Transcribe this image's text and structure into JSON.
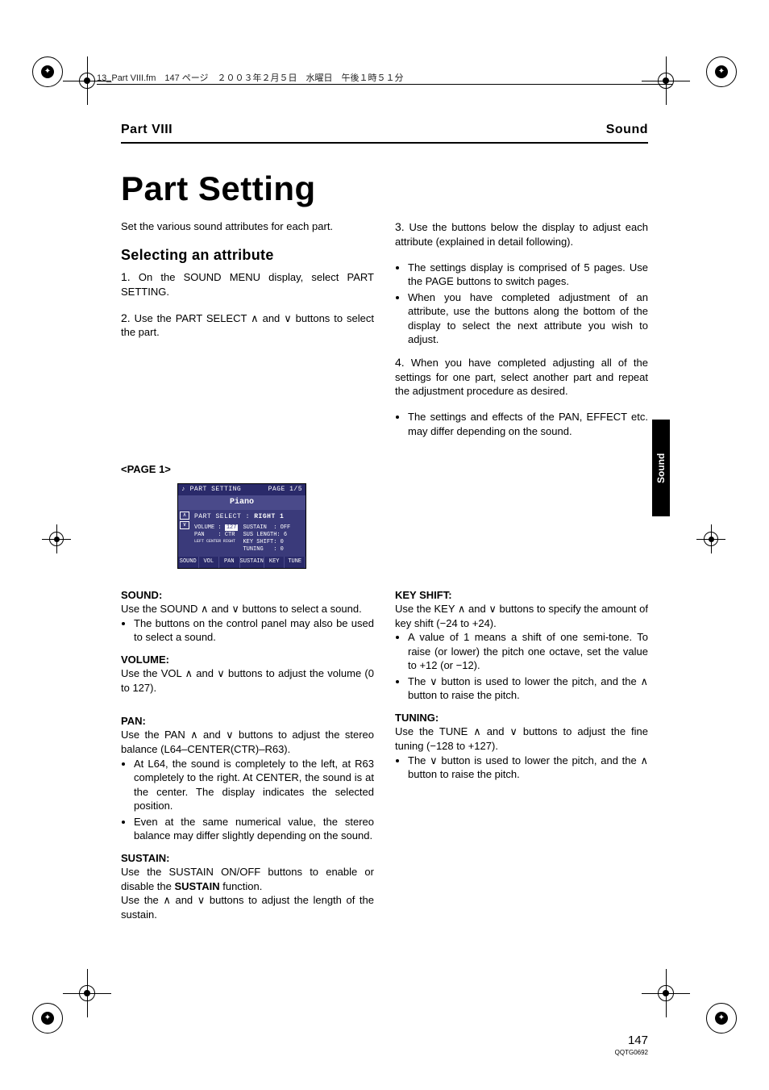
{
  "print_header": "13_Part VIII.fm　147 ページ　２００３年２月５日　水曜日　午後１時５１分",
  "header": {
    "part": "Part VIII",
    "section": "Sound"
  },
  "title": "Part Setting",
  "intro": "Set the various sound attributes for each part.",
  "subheading": "Selecting an attribute",
  "left_steps": [
    {
      "num": "1.",
      "text": "On the SOUND MENU display, select PART SETTING."
    },
    {
      "num": "2.",
      "text": "Use the PART SELECT ∧ and ∨ buttons to select the part."
    }
  ],
  "right_steps": [
    {
      "num": "3.",
      "text": "Use the buttons below the display to adjust each attribute (explained in detail following)."
    }
  ],
  "right_bullets_1": [
    "The settings display is comprised of 5 pages. Use the PAGE buttons to switch pages.",
    "When you have completed adjustment of an attribute, use the buttons along the bottom of the display to select the next attribute you wish to adjust."
  ],
  "right_step4": {
    "num": "4.",
    "text": "When you have completed adjusting all of the settings for one part, select another part and repeat the adjustment procedure as desired."
  },
  "right_bullets_2": [
    "The settings and effects of the PAN, EFFECT etc. may differ depending on the sound."
  ],
  "page1_label": "<PAGE 1>",
  "screenshot": {
    "title_left": "PART SETTING",
    "title_right": "PAGE 1/5",
    "sound_name": "Piano",
    "part_select_label": "PART SELECT :",
    "part_select_value": "RIGHT 1",
    "left_params": [
      {
        "label": "VOLUME",
        "value": "127"
      },
      {
        "label": "PAN",
        "value": "CTR"
      }
    ],
    "pan_scale": "LEFT   CENTER   RIGHT",
    "right_params": [
      {
        "label": "SUSTAIN",
        "value": "OFF"
      },
      {
        "label": "SUS LENGTH",
        "value": "6"
      },
      {
        "label": "KEY SHIFT",
        "value": "0"
      },
      {
        "label": "TUNING",
        "value": "0"
      }
    ],
    "footer": [
      "SOUND",
      "VOL",
      "PAN",
      "SUSTAIN",
      "KEY",
      "TUNE"
    ]
  },
  "sections_left": [
    {
      "head": "SOUND:",
      "body": "Use the SOUND ∧ and ∨  buttons to select a sound.",
      "bullets": [
        "The buttons on the control panel may also be used to select a sound."
      ]
    },
    {
      "head": "VOLUME:",
      "body": "Use the VOL ∧ and ∨ buttons to adjust the volume (0 to 127).",
      "bullets": []
    },
    {
      "head": "PAN:",
      "body": "Use the PAN ∧ and ∨ buttons to adjust the stereo balance (L64–CENTER(CTR)–R63).",
      "bullets": [
        "At L64, the sound is completely to the left, at R63 completely to the right. At CENTER, the sound is at the center. The display indicates the selected position.",
        "Even at the same numerical value, the stereo balance may differ slightly depending on the sound."
      ]
    },
    {
      "head": "SUSTAIN:",
      "body": "Use the SUSTAIN ON/OFF buttons to enable or disable the SUSTAIN function.",
      "body2": "Use the ∧ and ∨ buttons to adjust the length of the sustain.",
      "bullets": []
    }
  ],
  "sections_right": [
    {
      "head": "KEY SHIFT:",
      "body": "Use the KEY ∧ and ∨ buttons to specify the amount of key shift (−24 to +24).",
      "bullets": [
        "A value of 1 means a shift of one semi-tone. To raise (or lower) the pitch one octave, set the value to +12 (or −12).",
        "The ∨ button is used to lower the pitch, and the ∧ button to raise the pitch."
      ]
    },
    {
      "head": "TUNING:",
      "body": "Use the TUNE ∧ and ∨ buttons to adjust the fine tuning (−128 to +127).",
      "bullets": [
        "The ∨ button is used to lower the pitch, and the ∧ button to raise the pitch."
      ]
    }
  ],
  "side_tab": "Sound",
  "page_number": "147",
  "doc_code": "QQTG0692"
}
